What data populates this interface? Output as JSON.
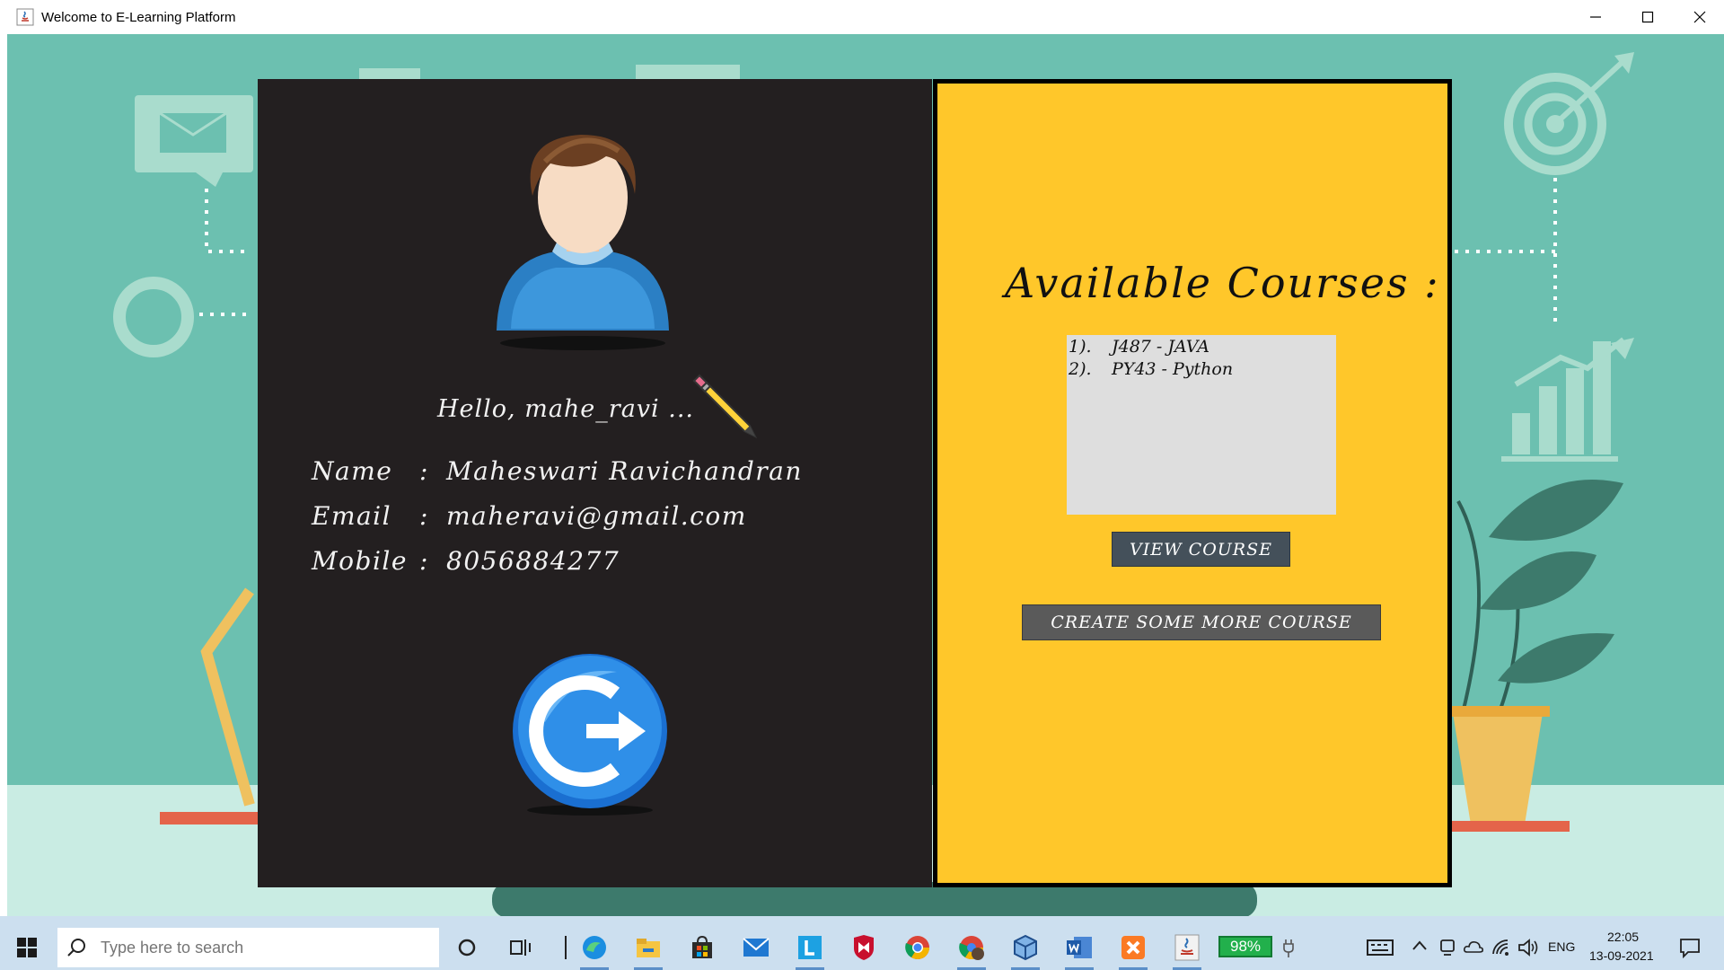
{
  "window": {
    "title": "Welcome to E-Learning Platform"
  },
  "profile": {
    "greeting": "Hello, mahe_ravi ...",
    "fields": [
      {
        "label": "Name",
        "value": "Maheswari Ravichandran"
      },
      {
        "label": "Email",
        "value": "maheravi@gmail.com"
      },
      {
        "label": "Mobile",
        "value": "8056884277"
      }
    ],
    "separator": ":"
  },
  "courses": {
    "title": "Available Courses :",
    "items": [
      {
        "num": "1).",
        "text": "J487  -  JAVA"
      },
      {
        "num": "2).",
        "text": "PY43  -  Python"
      }
    ],
    "view_button": "VIEW COURSE",
    "create_button": "CREATE SOME MORE COURSE"
  },
  "taskbar": {
    "search_placeholder": "Type here to search",
    "battery": "98%",
    "language": "ENG",
    "time": "22:05",
    "date": "13-09-2021"
  },
  "colors": {
    "scene_bg": "#6cc0b0",
    "profile_bg": "#231f20",
    "courses_bg": "#ffc72a",
    "view_button_bg": "#44505a",
    "create_button_bg": "#5a5a5a"
  },
  "icons": [
    "app-java-icon",
    "avatar-icon",
    "pencil-icon",
    "logout-icon",
    "windows-start-icon",
    "search-icon",
    "cortana-icon",
    "task-view-icon",
    "edge-icon",
    "file-explorer-icon",
    "store-icon",
    "mail-icon",
    "l-app-icon",
    "mcafee-icon",
    "chrome-icon",
    "chrome-profile-icon",
    "virtualbox-icon",
    "word-icon",
    "xampp-icon",
    "java-icon"
  ]
}
